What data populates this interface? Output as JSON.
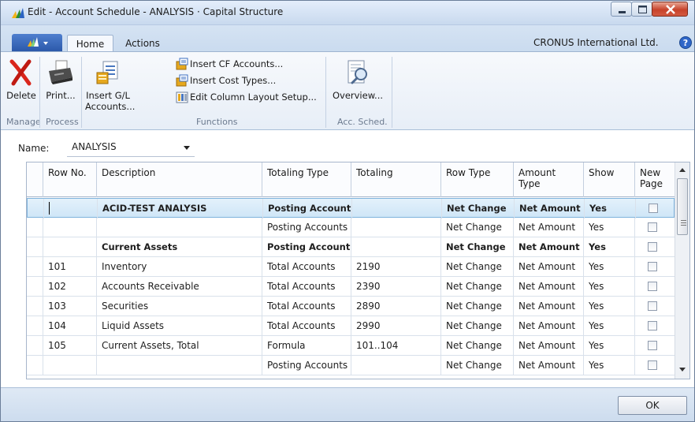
{
  "window": {
    "title": "Edit - Account Schedule - ANALYSIS · Capital Structure"
  },
  "ribbon": {
    "tabs": [
      {
        "label": "Home",
        "active": true
      },
      {
        "label": "Actions",
        "active": false
      }
    ],
    "company": "CRONUS International Ltd.",
    "groups": {
      "manage": {
        "label": "Manage",
        "delete": "Delete"
      },
      "process": {
        "label": "Process",
        "print": "Print..."
      },
      "functions": {
        "label": "Functions",
        "insert_gl_line1": "Insert G/L",
        "insert_gl_line2": "Accounts...",
        "insert_cf": "Insert CF Accounts...",
        "insert_cost": "Insert Cost Types...",
        "edit_column": "Edit Column Layout Setup..."
      },
      "acc_sched": {
        "label": "Acc. Sched.",
        "overview": "Overview..."
      }
    }
  },
  "name_field": {
    "label": "Name:",
    "value": "ANALYSIS"
  },
  "grid": {
    "columns": [
      "Row No.",
      "Description",
      "Totaling Type",
      "Totaling",
      "Row Type",
      "Amount Type",
      "Show",
      "New Page"
    ],
    "amount_type_hdr": [
      "Amount",
      "Type"
    ],
    "new_page_hdr": [
      "New",
      "Page"
    ],
    "rows": [
      {
        "row_no": "",
        "description": "ACID-TEST ANALYSIS",
        "totaling_type": "Posting Accounts",
        "totaling": "",
        "row_type": "Net Change",
        "amount_type": "Net Amount",
        "show": "Yes",
        "new_page": false,
        "bold": true,
        "selected": true
      },
      {
        "row_no": "",
        "description": "",
        "totaling_type": "Posting Accounts",
        "totaling": "",
        "row_type": "Net Change",
        "amount_type": "Net Amount",
        "show": "Yes",
        "new_page": false,
        "bold": false,
        "selected": false
      },
      {
        "row_no": "",
        "description": "Current Assets",
        "totaling_type": "Posting Accounts",
        "totaling": "",
        "row_type": "Net Change",
        "amount_type": "Net Amount",
        "show": "Yes",
        "new_page": false,
        "bold": true,
        "selected": false
      },
      {
        "row_no": "101",
        "description": "Inventory",
        "totaling_type": "Total Accounts",
        "totaling": "2190",
        "row_type": "Net Change",
        "amount_type": "Net Amount",
        "show": "Yes",
        "new_page": false,
        "bold": false,
        "selected": false
      },
      {
        "row_no": "102",
        "description": "Accounts Receivable",
        "totaling_type": "Total Accounts",
        "totaling": "2390",
        "row_type": "Net Change",
        "amount_type": "Net Amount",
        "show": "Yes",
        "new_page": false,
        "bold": false,
        "selected": false
      },
      {
        "row_no": "103",
        "description": "Securities",
        "totaling_type": "Total Accounts",
        "totaling": "2890",
        "row_type": "Net Change",
        "amount_type": "Net Amount",
        "show": "Yes",
        "new_page": false,
        "bold": false,
        "selected": false
      },
      {
        "row_no": "104",
        "description": "Liquid Assets",
        "totaling_type": "Total Accounts",
        "totaling": "2990",
        "row_type": "Net Change",
        "amount_type": "Net Amount",
        "show": "Yes",
        "new_page": false,
        "bold": false,
        "selected": false
      },
      {
        "row_no": "105",
        "description": "Current Assets, Total",
        "totaling_type": "Formula",
        "totaling": "101..104",
        "row_type": "Net Change",
        "amount_type": "Net Amount",
        "show": "Yes",
        "new_page": false,
        "bold": false,
        "selected": false
      },
      {
        "row_no": "",
        "description": "",
        "totaling_type": "Posting Accounts",
        "totaling": "",
        "row_type": "Net Change",
        "amount_type": "Net Amount",
        "show": "Yes",
        "new_page": false,
        "bold": false,
        "selected": false
      }
    ]
  },
  "footer": {
    "ok": "OK"
  }
}
